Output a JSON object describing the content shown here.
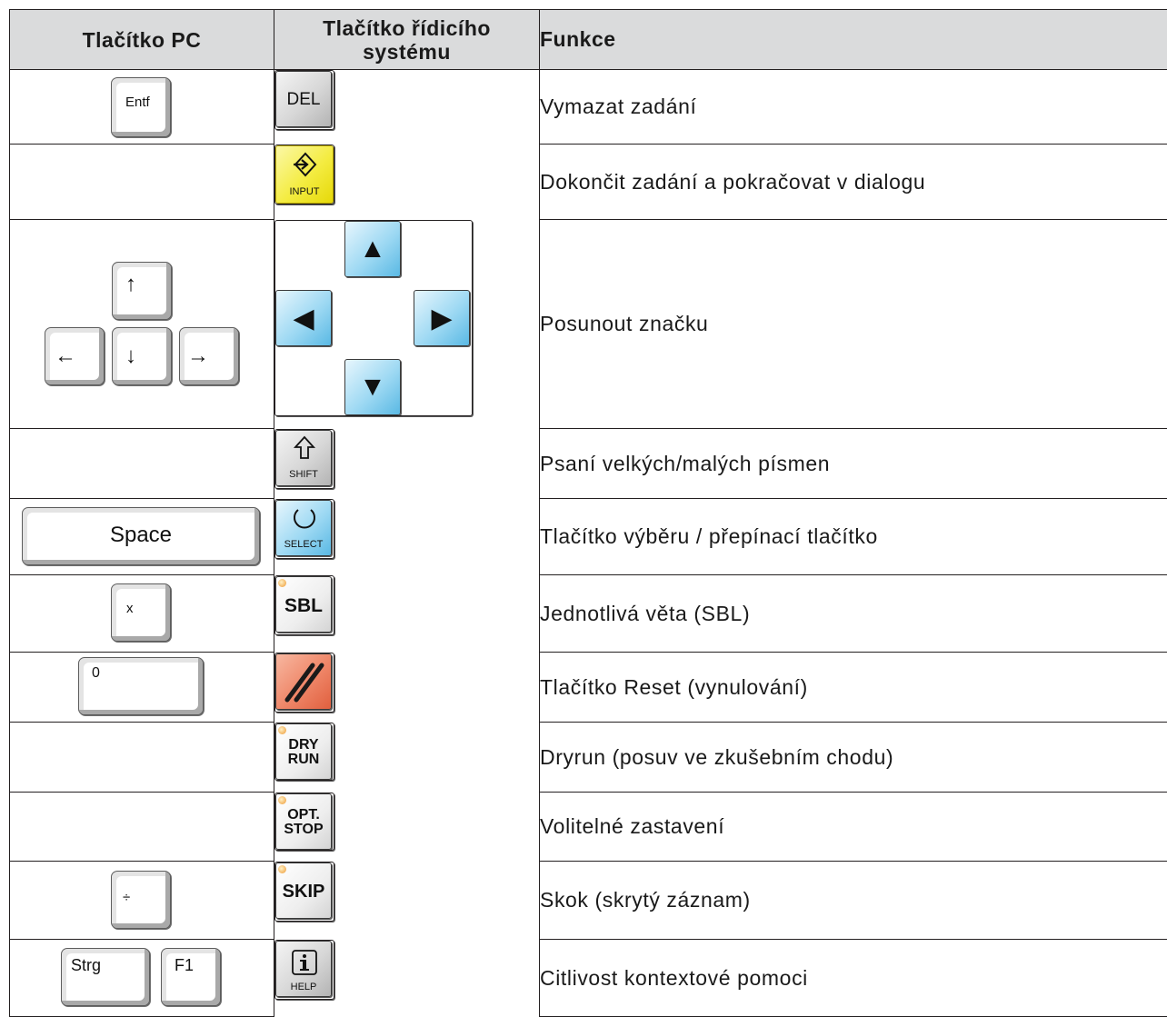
{
  "headers": {
    "pc_key": "Tlačítko PC",
    "control_key_line1": "Tlačítko řídicího",
    "control_key_line2": "systému",
    "function": "Funkce"
  },
  "rows": [
    {
      "pc_keys": [
        "Entf"
      ],
      "control_key": "DEL",
      "function": "Vymazat zadání"
    },
    {
      "pc_keys": [],
      "control_key": "INPUT",
      "control_icon": "input-arrow-icon",
      "function": "Dokončit zadání a pokračovat v dialogu"
    },
    {
      "pc_keys": [
        "↑",
        "←",
        "↓",
        "→"
      ],
      "control_keys": [
        "▲",
        "◀",
        "▶",
        "▼"
      ],
      "function": "Posunout značku"
    },
    {
      "pc_keys": [],
      "control_key": "SHIFT",
      "control_icon": "shift-arrow-icon",
      "function": "Psaní velkých/malých písmen"
    },
    {
      "pc_keys": [
        "Space"
      ],
      "control_key": "SELECT",
      "control_icon": "select-circle-icon",
      "function": "Tlačítko výběru / přepínací tlačítko"
    },
    {
      "pc_keys": [
        "x"
      ],
      "control_key": "SBL",
      "function": "Jednotlivá věta (SBL)"
    },
    {
      "pc_keys": [
        "0"
      ],
      "control_key": "",
      "control_icon": "reset-slash-icon",
      "function": "Tlačítko Reset (vynulování)"
    },
    {
      "pc_keys": [],
      "control_key_line1": "DRY",
      "control_key_line2": "RUN",
      "function": "Dryrun (posuv ve zkušebním chodu)"
    },
    {
      "pc_keys": [],
      "control_key_line1": "OPT.",
      "control_key_line2": "STOP",
      "function": "Volitelné zastavení"
    },
    {
      "pc_keys": [
        "÷"
      ],
      "control_key": "SKIP",
      "function": "Skok (skrytý záznam)"
    },
    {
      "pc_keys": [
        "Strg",
        "F1"
      ],
      "control_key": "HELP",
      "control_icon": "info-i-icon",
      "function": "Citlivost kontextové pomoci"
    }
  ],
  "colors": {
    "header_bg": "#dadbdc",
    "input_key": "#f4ec42",
    "arrow_key": "#9ed9f3",
    "select_key": "#9ed9f3",
    "reset_key": "#ef8668",
    "lamp": "#f3b25d"
  }
}
